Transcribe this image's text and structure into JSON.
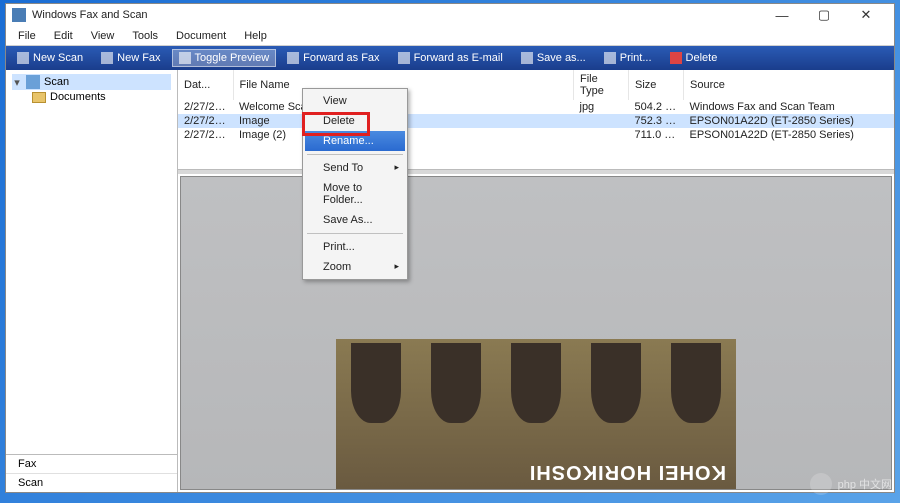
{
  "title": "Windows Fax and Scan",
  "menubar": [
    "File",
    "Edit",
    "View",
    "Tools",
    "Document",
    "Help"
  ],
  "toolbar": {
    "new_scan": "New Scan",
    "new_fax": "New Fax",
    "toggle_preview": "Toggle Preview",
    "forward_fax": "Forward as Fax",
    "forward_email": "Forward as E-mail",
    "save_as": "Save as...",
    "print": "Print...",
    "delete": "Delete"
  },
  "tree": {
    "root": "Scan",
    "documents": "Documents"
  },
  "sidebar_bottom": {
    "fax": "Fax",
    "scan": "Scan"
  },
  "columns": {
    "date": "Dat...",
    "filename": "File Name",
    "filetype": "File Type",
    "size": "Size",
    "source": "Source"
  },
  "rows": [
    {
      "date": "2/27/202...",
      "name": "Welcome Scan",
      "type": "jpg",
      "size": "504.2 KB",
      "source": "Windows Fax and Scan Team"
    },
    {
      "date": "2/27/202...",
      "name": "Image",
      "type": "",
      "size": "752.3 KB",
      "source": "EPSON01A22D (ET-2850 Series)"
    },
    {
      "date": "2/27/202...",
      "name": "Image (2)",
      "type": "",
      "size": "711.0 KB",
      "source": "EPSON01A22D (ET-2850 Series)"
    }
  ],
  "context_menu": {
    "view": "View",
    "delete": "Delete",
    "rename": "Rename...",
    "send_to": "Send To",
    "move_to": "Move to Folder...",
    "save_as": "Save As...",
    "print": "Print...",
    "zoom": "Zoom"
  },
  "preview_text": "KOHEI HORIKOSHI",
  "watermark": "php 中文网"
}
